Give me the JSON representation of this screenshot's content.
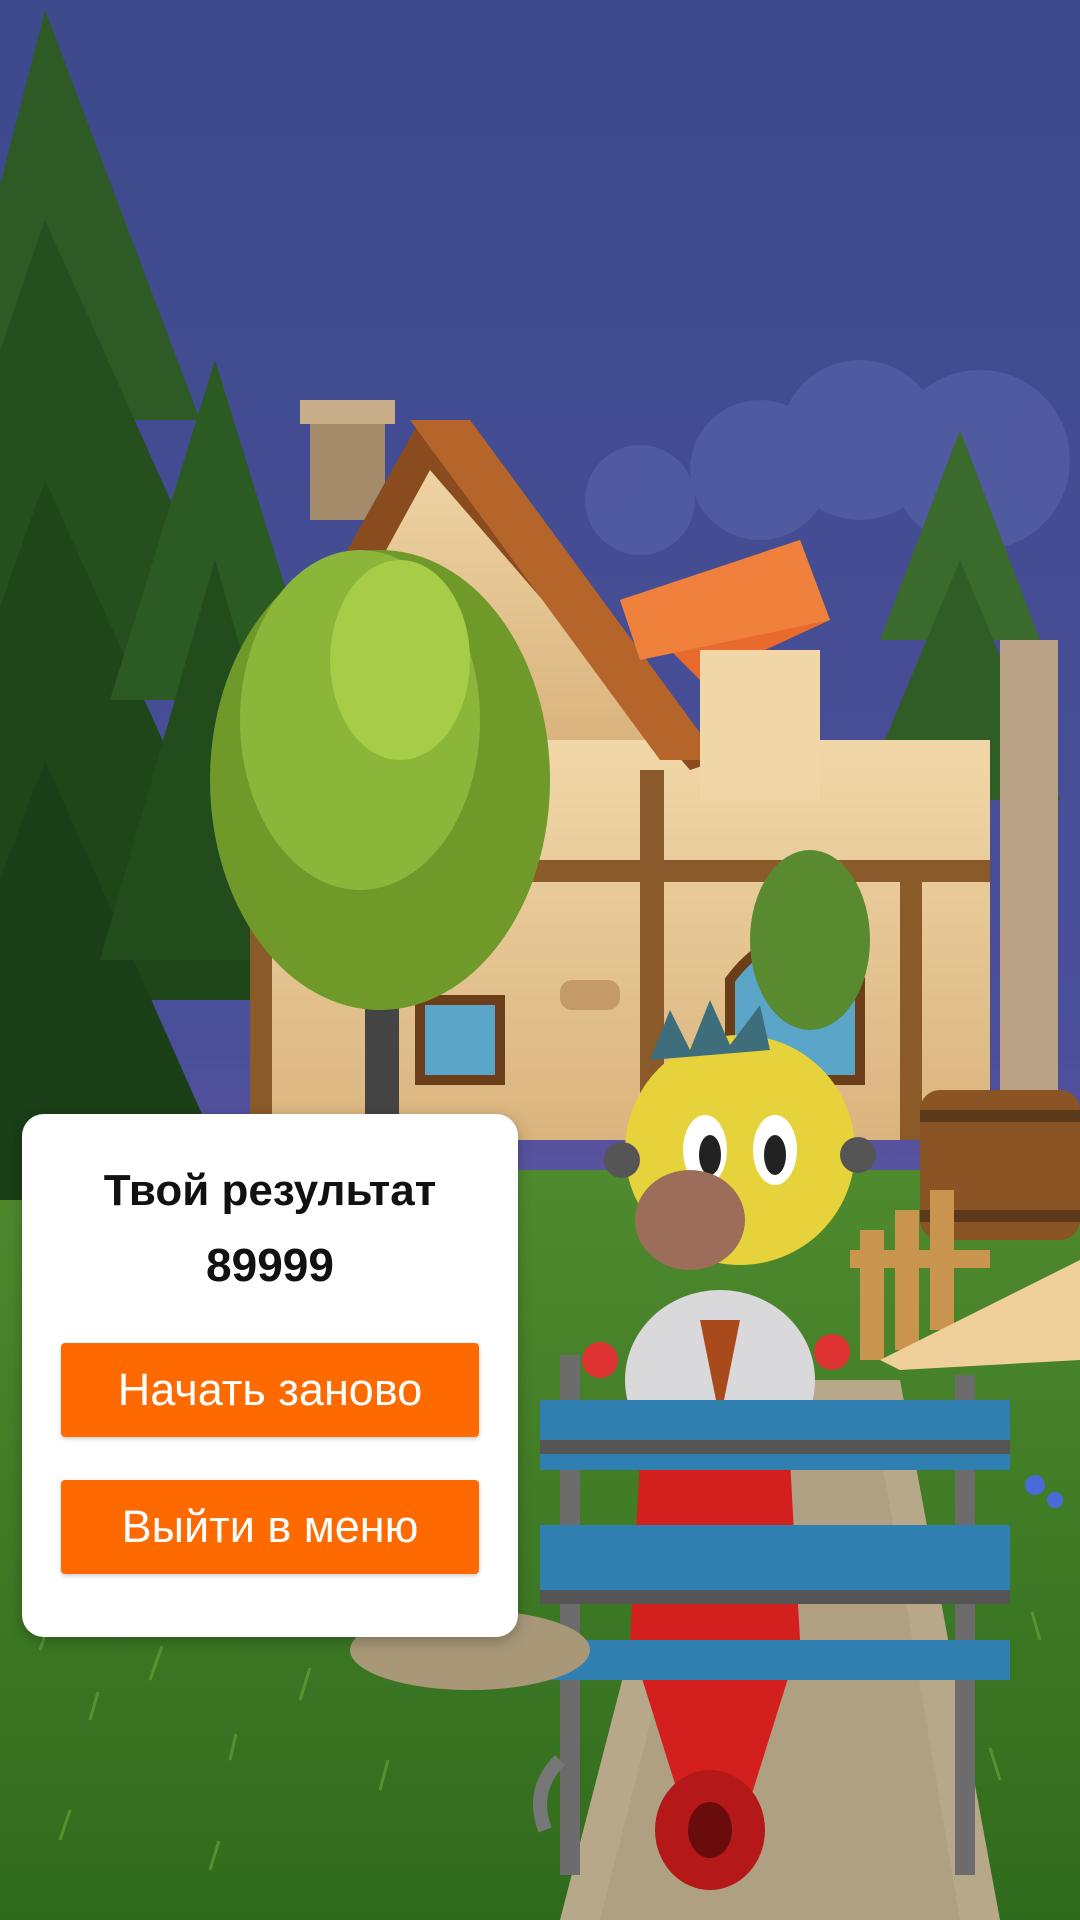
{
  "result_dialog": {
    "title": "Твой результат",
    "score": "89999",
    "restart_label": "Начать заново",
    "menu_label": "Выйти в меню"
  },
  "colors": {
    "button": "#ff6a00",
    "dialog_bg": "#ffffff",
    "sky": "#3d4a8a"
  },
  "scene": {
    "description_icons": [
      "house",
      "pine-trees",
      "bush-tree",
      "bird-character",
      "red-scooter",
      "blue-barrier",
      "barrel",
      "wooden-fence"
    ]
  }
}
